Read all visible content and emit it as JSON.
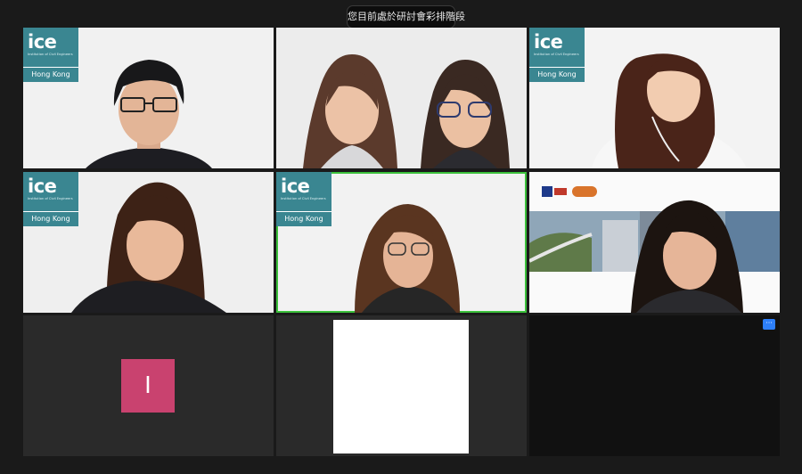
{
  "banner": {
    "text": "您目前處於研討會彩排階段"
  },
  "badge": {
    "logo_text": "ice",
    "logo_subtext": "Institution of Civil Engineers",
    "region": "Hong Kong"
  },
  "participants": [
    {
      "tile": "participant-1",
      "has_badge": true
    },
    {
      "tile": "participant-2",
      "has_badge": false
    },
    {
      "tile": "participant-3",
      "has_badge": true
    },
    {
      "tile": "participant-4",
      "has_badge": true
    },
    {
      "tile": "participant-5",
      "has_badge": true,
      "active_speaker": true
    },
    {
      "tile": "participant-6",
      "has_badge": false
    },
    {
      "tile": "participant-7",
      "initial": "I",
      "avatar_color": "#c9426f"
    },
    {
      "tile": "participant-8",
      "video_off": true
    },
    {
      "tile": "participant-9",
      "empty": true
    }
  ],
  "controls": {
    "more_icon": "ellipsis-icon",
    "more_label": "···"
  },
  "colors": {
    "ice_teal": "#3a8691",
    "active_outline": "#3cc13c",
    "background": "#1a1a1a",
    "avatar": "#c9426f",
    "more_button": "#2d7ff9"
  }
}
